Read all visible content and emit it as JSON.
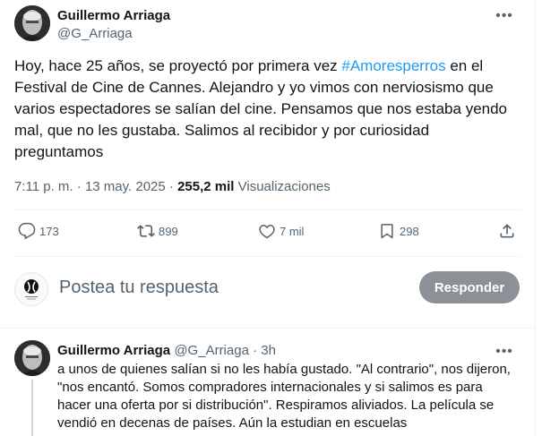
{
  "main_tweet": {
    "author_name": "Guillermo Arriaga",
    "author_handle": "@G_Arriaga",
    "text_before": "Hoy, hace 25 años, se proyectó por primera vez ",
    "hashtag": "#Amoresperros",
    "text_after": " en el Festival de Cine de Cannes. Alejandro y yo vimos con nerviosismo que varios espectadores se salían del cine. Pensamos que nos estaba yendo mal, que no les gustaba. Salimos al recibidor y por curiosidad preguntamos",
    "time": "7:11 p. m.",
    "sep": " · ",
    "date": "13 may. 2025",
    "views_count": "255,2 mil",
    "views_label": "Visualizaciones",
    "more_icon": "more-horizontal-icon"
  },
  "actions": {
    "replies": "173",
    "retweets": "899",
    "likes": "7 mil",
    "bookmarks": "298"
  },
  "composer": {
    "placeholder": "Postea tu respuesta",
    "button_label": "Responder",
    "button_color": "#8b9196"
  },
  "reply_tweet": {
    "author_name": "Guillermo Arriaga",
    "author_handle": "@G_Arriaga",
    "dot": " · ",
    "time_ago": "3h",
    "text": "a unos de quienes salían si no les había gustado. \"Al contrario\", nos dijeron, \"nos encantó. Somos compradores internacionales y si salimos es para hacer una oferta por si distribución\". Respiramos aliviados. La película se vendió en decenas de países. Aún la estudian en escuelas"
  },
  "colors": {
    "accent": "#1d9bf0",
    "muted": "#536471",
    "text": "#0f1419"
  }
}
